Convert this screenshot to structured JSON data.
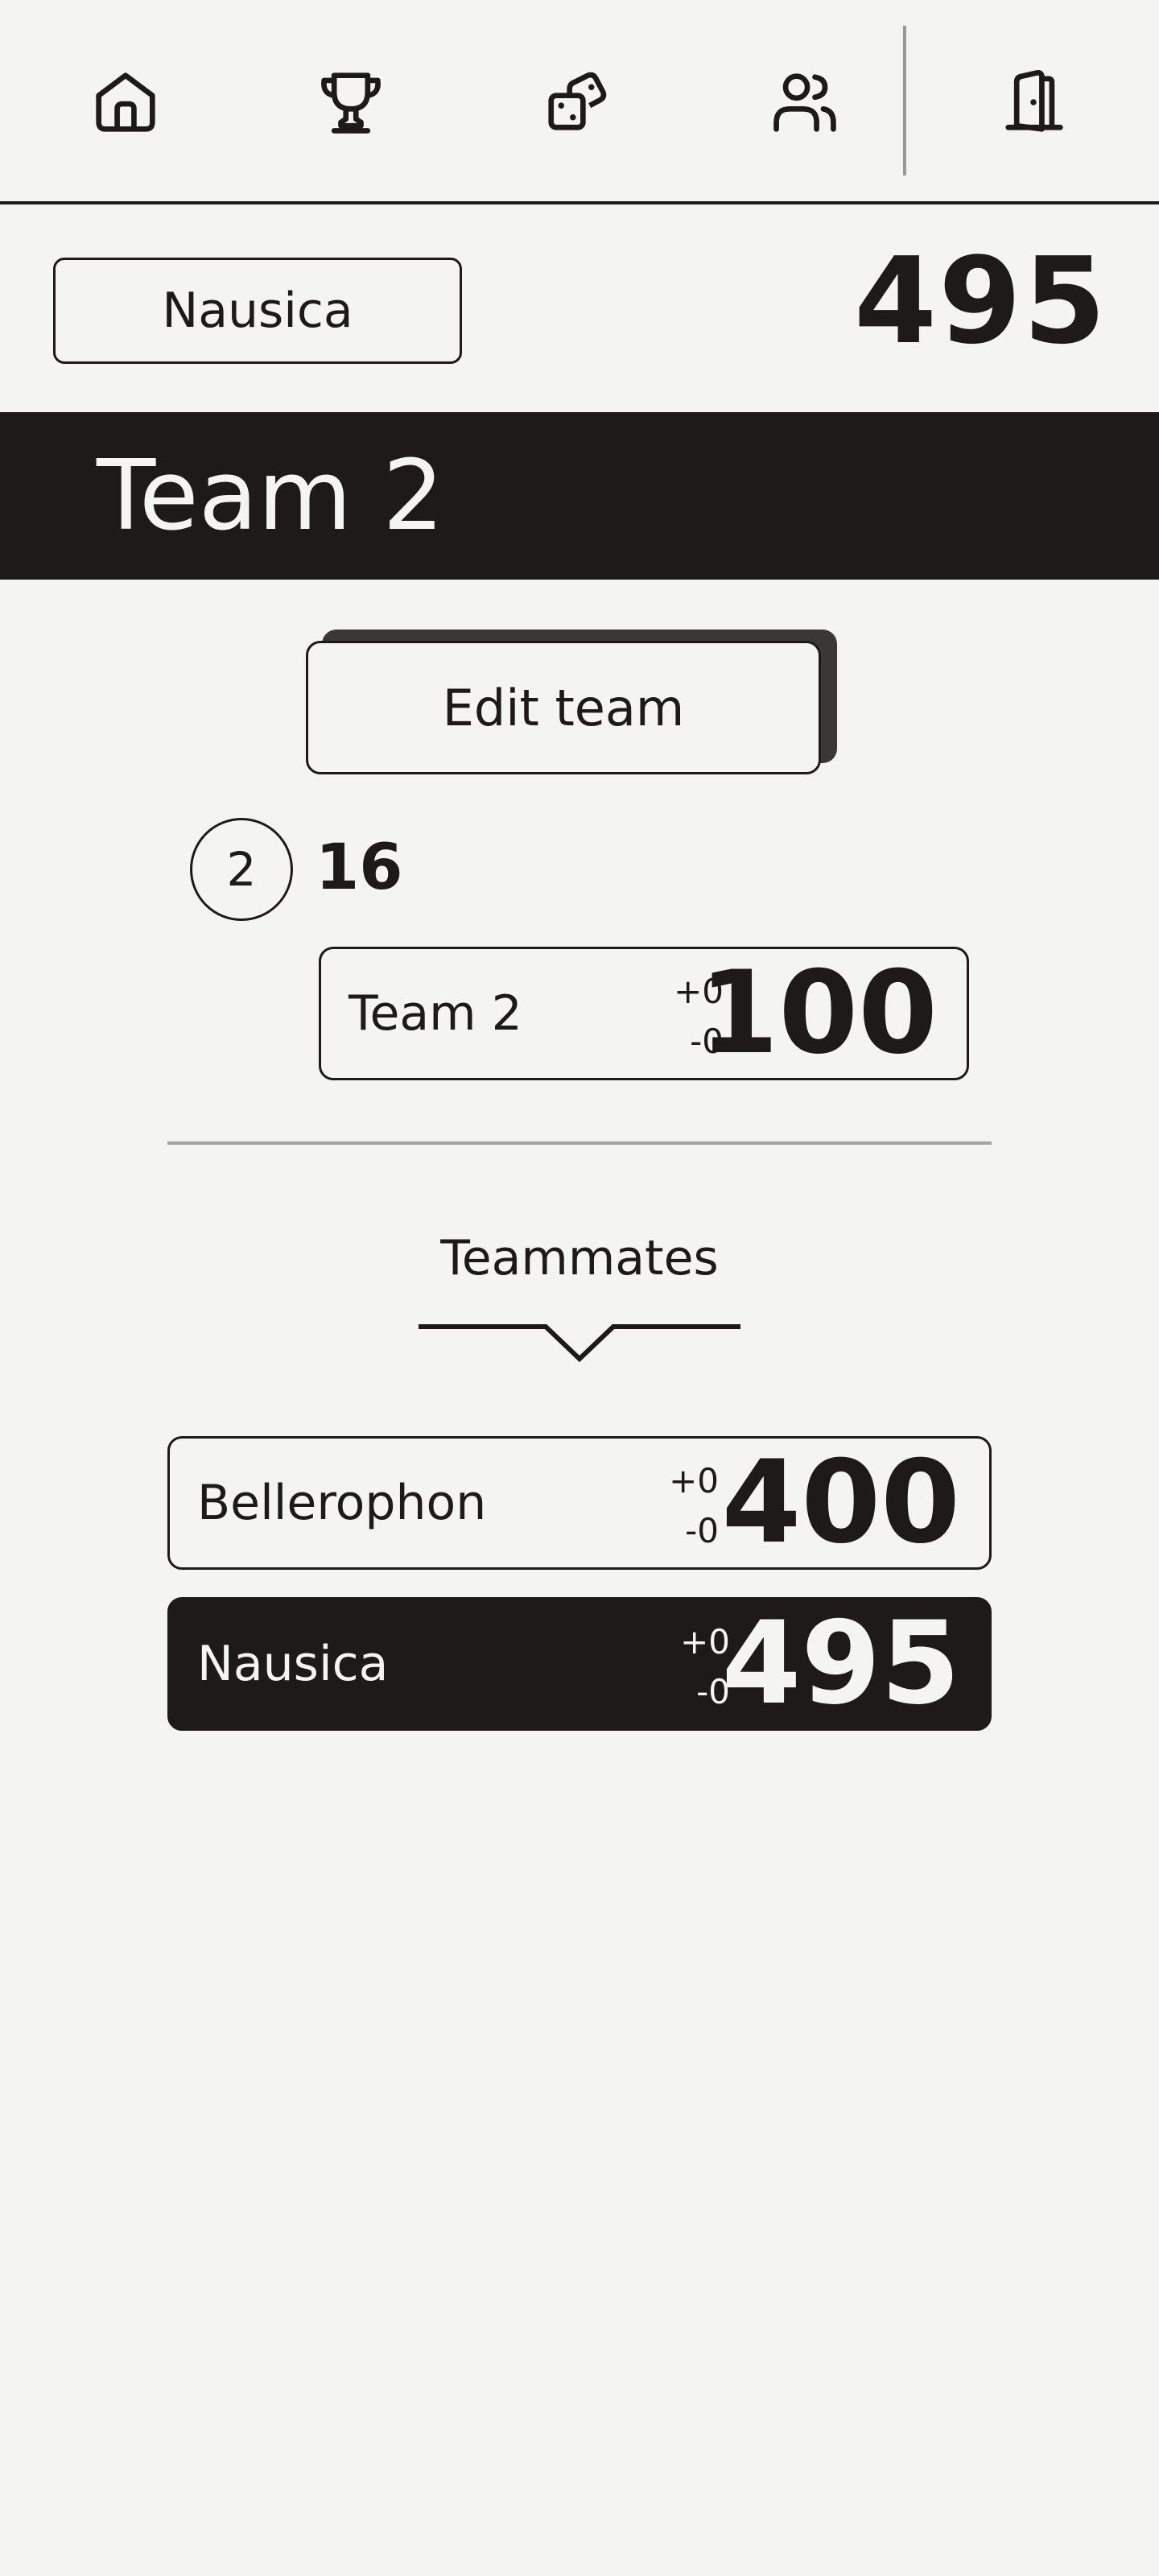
{
  "nav": {
    "items": [
      {
        "icon": "home-icon",
        "label": "Home"
      },
      {
        "icon": "trophy-icon",
        "label": "Leaderboard"
      },
      {
        "icon": "dice-icon",
        "label": "Games"
      },
      {
        "icon": "users-icon",
        "label": "Teams"
      },
      {
        "icon": "door-exit-icon",
        "label": "Exit"
      }
    ]
  },
  "header": {
    "player_name": "Nausica",
    "player_score": "495"
  },
  "team": {
    "title": "Team 2",
    "edit_label": "Edit team",
    "rank": "2",
    "points": "16",
    "card": {
      "name": "Team 2",
      "plus": "+0",
      "minus": "-0",
      "score": "100"
    }
  },
  "teammates": {
    "heading": "Teammates",
    "members": [
      {
        "name": "Bellerophon",
        "plus": "+0",
        "minus": "-0",
        "score": "400",
        "highlighted": false
      },
      {
        "name": "Nausica",
        "plus": "+0",
        "minus": "-0",
        "score": "495",
        "highlighted": true
      }
    ]
  },
  "colors": {
    "background": "#f4f4f2",
    "ink": "#1e1a19",
    "divider": "#a6a4a2"
  }
}
